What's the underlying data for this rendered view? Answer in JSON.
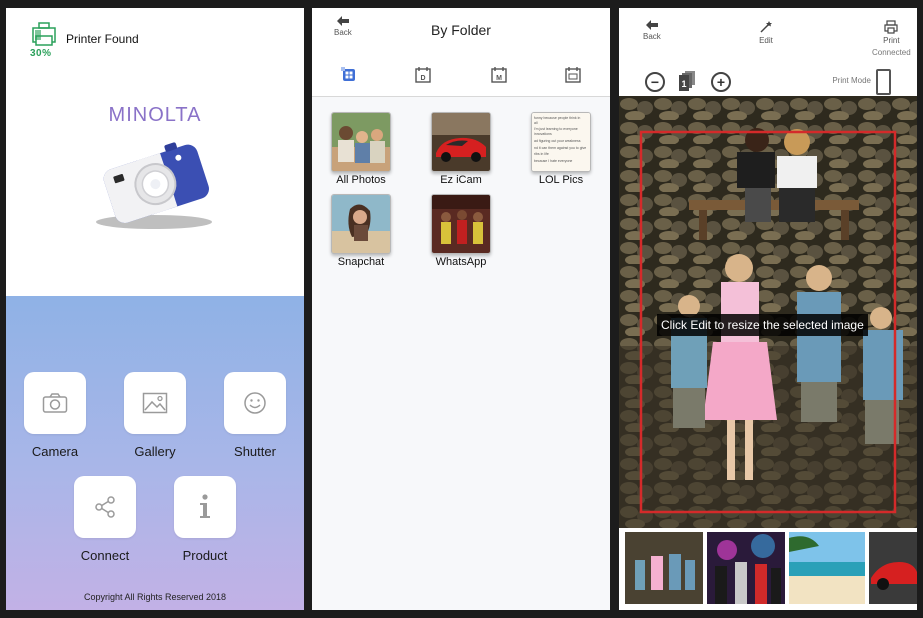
{
  "home": {
    "battery_pct": "30%",
    "printer_status": "Printer Found",
    "brand": "MINOLTA",
    "tiles": [
      {
        "label": "Camera"
      },
      {
        "label": "Gallery"
      },
      {
        "label": "Shutter"
      },
      {
        "label": "Connect"
      },
      {
        "label": "Product"
      }
    ],
    "copyright": "Copyright All Rights Reserved 2018",
    "colors": {
      "brand": "#8a72c8",
      "gradient_top": "#8fb2e6",
      "gradient_bottom": "#c2b1e6",
      "battery": "#2aa05a"
    }
  },
  "folders_screen": {
    "back_label": "Back",
    "title": "By Folder",
    "tabs": [
      {
        "icon": "folder-grid-icon",
        "label": ""
      },
      {
        "icon": "calendar-day-icon",
        "label": "D"
      },
      {
        "icon": "calendar-month-icon",
        "label": "M"
      },
      {
        "icon": "calendar-year-icon",
        "label": ""
      }
    ],
    "folders": [
      {
        "name": "All Photos"
      },
      {
        "name": "Ez iCam"
      },
      {
        "name": "LOL Pics"
      },
      {
        "name": "Snapchat"
      },
      {
        "name": "WhatsApp"
      }
    ],
    "lol_note_lines": [
      "funny because people think in",
      "all",
      "I'm just learning to everyone",
      "innovations",
      "ad figuring out your weakness",
      "nd it can them against you to give",
      "ribs in life",
      "because I hate everyone"
    ]
  },
  "editor": {
    "back_label": "Back",
    "edit_label": "Edit",
    "print_label": "Print",
    "print_status": "Connected",
    "print_mode_label": "Print Mode",
    "copies_count": "1",
    "hint": "Click Edit to resize the selected image",
    "selection_color": "#d42a2a"
  }
}
